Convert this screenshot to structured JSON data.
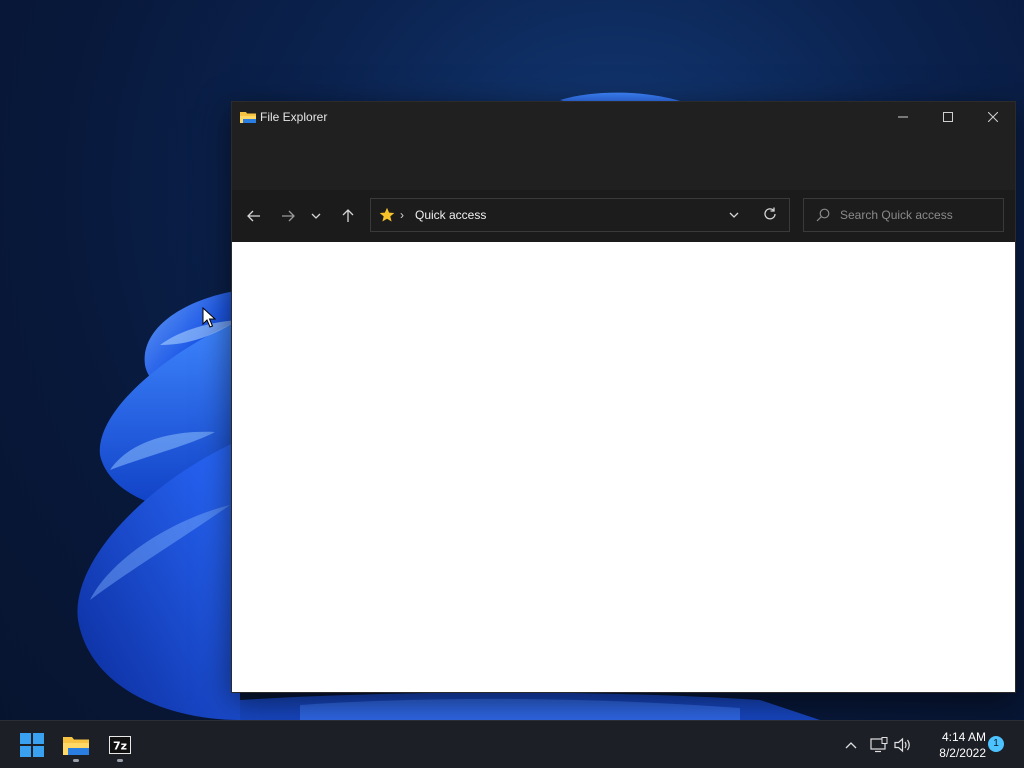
{
  "window": {
    "title": "File Explorer",
    "icon": "folder-icon",
    "controls": [
      "minimize-icon",
      "maximize-icon",
      "close-icon"
    ]
  },
  "navigation": {
    "back_icon": "arrow-left-icon",
    "forward_icon": "arrow-right-icon",
    "recent_icon": "chevron-down-icon",
    "up_icon": "arrow-up-icon"
  },
  "address_bar": {
    "location_icon": "star-icon",
    "separator": "›",
    "location": "Quick access"
  },
  "search": {
    "placeholder": "Search Quick access",
    "value": ""
  },
  "taskbar": {
    "pinned": [
      {
        "name": "Start",
        "icon": "windows-start-icon"
      },
      {
        "name": "File Explorer",
        "icon": "folder-icon"
      },
      {
        "name": "7-Zip",
        "icon": "7zip-icon"
      }
    ],
    "tray": {
      "overflow_icon": "chevron-up-icon",
      "network_icon": "network-icon",
      "volume_icon": "speaker-icon"
    },
    "time": "4:14 AM",
    "date": "8/2/2022",
    "notification_count": "1"
  },
  "colors": {
    "accent": "#4cc2ff",
    "window_bg": "#202020",
    "content_bg": "#ffffff",
    "star": "#f5c22b"
  }
}
